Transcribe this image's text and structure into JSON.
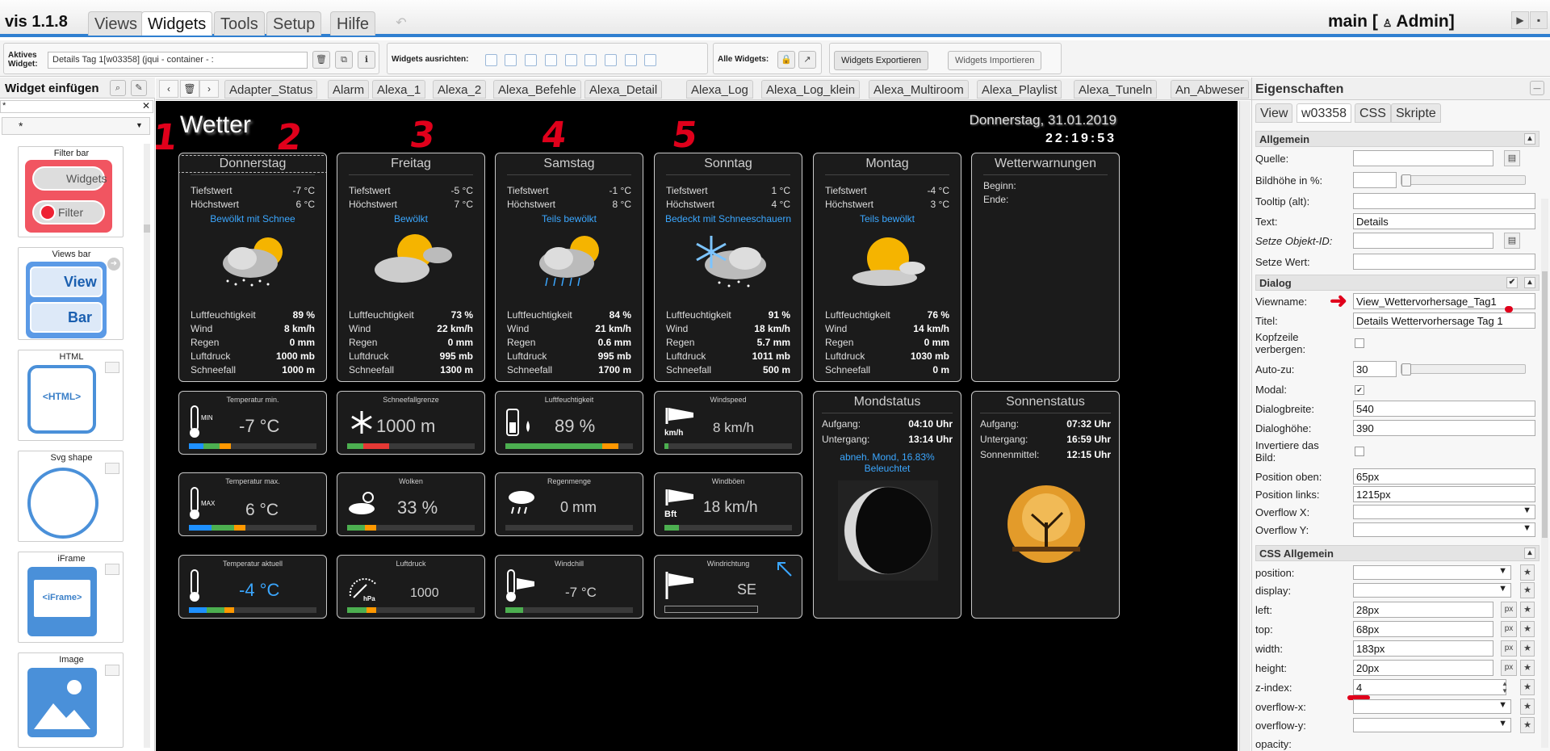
{
  "app": {
    "name": "vis 1.1.8",
    "menu": [
      "Views",
      "Widgets",
      "Tools",
      "Setup",
      "Hilfe"
    ],
    "active_menu": "Widgets",
    "project": "main [",
    "user_icon": "user-icon",
    "user": "Admin]"
  },
  "toolbar": {
    "active_widget_label": "Aktives\nWidget:",
    "active_widget_value": "Details Tag 1[w03358] (jqui - container - :",
    "align_label": "Widgets ausrichten:",
    "all_widgets_label": "Alle Widgets:",
    "export_label": "Widgets Exportieren",
    "import_label": "Widgets Importieren"
  },
  "palette": {
    "title": "Widget einfügen",
    "filter_value": "*",
    "select_value": "*",
    "items": [
      {
        "title": "Filter bar",
        "b1": "Widgets",
        "b2": "Filter"
      },
      {
        "title": "Views bar",
        "b1": "View",
        "b2": "Bar"
      },
      {
        "title": "HTML",
        "b1": "<HTML>"
      },
      {
        "title": "Svg shape"
      },
      {
        "title": "iFrame",
        "b1": "<iFrame>"
      },
      {
        "title": "Image"
      }
    ]
  },
  "views": [
    "Adapter_Status",
    "Alarm",
    "Alexa_1",
    "Alexa_2",
    "Alexa_Befehle",
    "Alexa_Detail",
    "Alexa_Log",
    "Alexa_Log_klein",
    "Alexa_Multiroom",
    "Alexa_Playlist",
    "Alexa_Tuneln",
    "An_Abweser"
  ],
  "weather": {
    "title": "Wetter",
    "date": "Donnerstag, 31.01.2019",
    "time": "22:19:53",
    "row_labels": {
      "low": "Tiefstwert",
      "high": "Höchstwert",
      "hum": "Luftfeuchtigkeit",
      "wind": "Wind",
      "rain": "Regen",
      "press": "Luftdruck",
      "snow": "Schneefall"
    },
    "days": [
      {
        "name": "Donnerstag",
        "low": "-7 °C",
        "high": "6 °C",
        "cond": "Bewölkt mit Schnee",
        "hum": "89 %",
        "wind": "8 km/h",
        "rain": "0 mm",
        "press": "1000 mb",
        "snow": "1000 m"
      },
      {
        "name": "Freitag",
        "low": "-5 °C",
        "high": "7 °C",
        "cond": "Bewölkt",
        "hum": "73 %",
        "wind": "22 km/h",
        "rain": "0 mm",
        "press": "995 mb",
        "snow": "1300 m"
      },
      {
        "name": "Samstag",
        "low": "-1 °C",
        "high": "8 °C",
        "cond": "Teils bewölkt",
        "hum": "84 %",
        "wind": "21 km/h",
        "rain": "0.6 mm",
        "press": "995 mb",
        "snow": "1700 m"
      },
      {
        "name": "Sonntag",
        "low": "1 °C",
        "high": "4 °C",
        "cond": "Bedeckt mit Schneeschauern",
        "hum": "91 %",
        "wind": "18 km/h",
        "rain": "5.7 mm",
        "press": "1011 mb",
        "snow": "500 m"
      },
      {
        "name": "Montag",
        "low": "-4 °C",
        "high": "3 °C",
        "cond": "Teils bewölkt",
        "hum": "76 %",
        "wind": "14 km/h",
        "rain": "0 mm",
        "press": "1030 mb",
        "snow": "0 m"
      }
    ],
    "warn": {
      "title": "Wetterwarnungen",
      "begin": "Beginn:",
      "end": "Ende:"
    },
    "tiles": [
      {
        "label": "Temperatur min.",
        "value": "-7 °C",
        "icon": "thermometer-min-icon",
        "icon_text": "MIN"
      },
      {
        "label": "Schneefallgrenze",
        "value": "1000 m",
        "icon": "snowflake-icon"
      },
      {
        "label": "Luftfeuchtigkeit",
        "value": "89 %",
        "icon": "humidity-icon"
      },
      {
        "label": "Windspeed",
        "value": "8 km/h",
        "icon": "windsock-icon",
        "icon_text": "km/h"
      },
      {
        "label": "Temperatur max.",
        "value": "6 °C",
        "icon": "thermometer-max-icon",
        "icon_text": "MAX"
      },
      {
        "label": "Wolken",
        "value": "33 %",
        "icon": "clouds-icon"
      },
      {
        "label": "Regenmenge",
        "value": "0 mm",
        "icon": "rain-icon"
      },
      {
        "label": "Windböen",
        "value": "18 km/h",
        "icon": "windsock-icon",
        "icon_text": "Bft"
      },
      {
        "label": "Temperatur aktuell",
        "value": "-4 °C",
        "icon": "thermometer-icon"
      },
      {
        "label": "Luftdruck",
        "value": "1000",
        "icon": "barometer-icon",
        "icon_text": "hPa"
      },
      {
        "label": "Windchill",
        "value": "-7 °C",
        "icon": "windchill-icon"
      },
      {
        "label": "Windrichtung",
        "value": "SE",
        "icon": "windsock-icon"
      }
    ],
    "moon": {
      "title": "Mondstatus",
      "rise_label": "Aufgang:",
      "rise": "04:10 Uhr",
      "set_label": "Untergang:",
      "set": "13:14 Uhr",
      "phase": "abneh. Mond, 16.83%\nBeleuchtet"
    },
    "sun": {
      "title": "Sonnenstatus",
      "rise_label": "Aufgang:",
      "rise": "07:32 Uhr",
      "set_label": "Untergang:",
      "set": "16:59 Uhr",
      "noon_label": "Sonnenmittel:",
      "noon": "12:15 Uhr"
    },
    "markers": [
      "1",
      "2",
      "3",
      "4",
      "5"
    ]
  },
  "props": {
    "title": "Eigenschaften",
    "tabs": [
      "View",
      "w03358",
      "CSS",
      "Skripte"
    ],
    "sections": {
      "allg": "Allgemein",
      "dialog": "Dialog",
      "css": "CSS Allgemein"
    },
    "fields": {
      "quelle": {
        "label": "Quelle:",
        "value": ""
      },
      "bildhoehe": {
        "label": "Bildhöhe in %:",
        "value": ""
      },
      "tooltip": {
        "label": "Tooltip (alt):",
        "value": ""
      },
      "text": {
        "label": "Text:",
        "value": "Details"
      },
      "objid": {
        "label": "Setze Objekt-ID:",
        "value": ""
      },
      "wert": {
        "label": "Setze Wert:",
        "value": ""
      },
      "viewname": {
        "label": "Viewname:",
        "value": "View_Wettervorhersage_Tag1"
      },
      "titel": {
        "label": "Titel:",
        "value": "Details Wettervorhersage Tag 1"
      },
      "kopfzeile": {
        "label": "Kopfzeile\nverbergen:"
      },
      "autozu": {
        "label": "Auto-zu:",
        "value": "30"
      },
      "modal": {
        "label": "Modal:"
      },
      "dlgbreite": {
        "label": "Dialogbreite:",
        "value": "540"
      },
      "dlghoehe": {
        "label": "Dialoghöhe:",
        "value": "390"
      },
      "invert": {
        "label": "Invertiere das\nBild:"
      },
      "posoben": {
        "label": "Position oben:",
        "value": "65px"
      },
      "poslinks": {
        "label": "Position links:",
        "value": "1215px"
      },
      "ovx": {
        "label": "Overflow X:",
        "value": ""
      },
      "ovy": {
        "label": "Overflow Y:",
        "value": ""
      },
      "position": {
        "label": "position:",
        "value": ""
      },
      "display": {
        "label": "display:",
        "value": ""
      },
      "left": {
        "label": "left:",
        "value": "28px"
      },
      "top": {
        "label": "top:",
        "value": "68px"
      },
      "width": {
        "label": "width:",
        "value": "183px"
      },
      "height": {
        "label": "height:",
        "value": "20px"
      },
      "zindex": {
        "label": "z-index:",
        "value": "4"
      },
      "overflowx": {
        "label": "overflow-x:",
        "value": ""
      },
      "overflowy": {
        "label": "overflow-y:",
        "value": ""
      },
      "opacity": {
        "label": "opacity:"
      }
    },
    "unit": "px"
  }
}
